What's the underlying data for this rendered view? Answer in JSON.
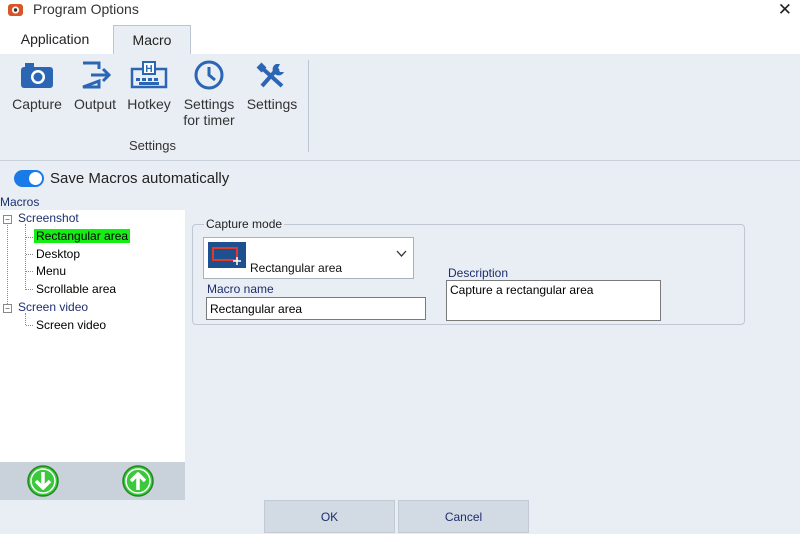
{
  "window": {
    "title": "Program Options",
    "close_glyph": "✕"
  },
  "tabs": [
    {
      "label": "Application"
    },
    {
      "label": "Macro"
    }
  ],
  "ribbon": {
    "buttons": [
      {
        "label": "Capture",
        "icon": "camera-icon"
      },
      {
        "label": "Output",
        "icon": "output-icon"
      },
      {
        "label": "Hotkey",
        "icon": "hotkey-icon"
      },
      {
        "label": "Settings for timer",
        "icon": "timer-icon"
      },
      {
        "label": "Settings",
        "icon": "tools-icon"
      }
    ],
    "group_label": "Settings"
  },
  "toggle": {
    "label": "Save Macros automatically",
    "on": true
  },
  "macros": {
    "title": "Macros",
    "groups": [
      {
        "label": "Screenshot",
        "items": [
          "Rectangular area",
          "Desktop",
          "Menu",
          "Scrollable area"
        ]
      },
      {
        "label": "Screen video",
        "items": [
          "Screen video"
        ]
      }
    ],
    "selected": "Rectangular area"
  },
  "form": {
    "capture_mode_label": "Capture mode",
    "capture_mode_value": "Rectangular area",
    "macro_name_label": "Macro name",
    "macro_name_value": "Rectangular area",
    "description_label": "Description",
    "description_value": "Capture a rectangular area"
  },
  "buttons": {
    "ok": "OK",
    "cancel": "Cancel"
  },
  "colors": {
    "accent": "#1a7ae8",
    "selection": "#14ee14",
    "icon": "#2b66b5",
    "arrow_green": "#3cc83c"
  }
}
